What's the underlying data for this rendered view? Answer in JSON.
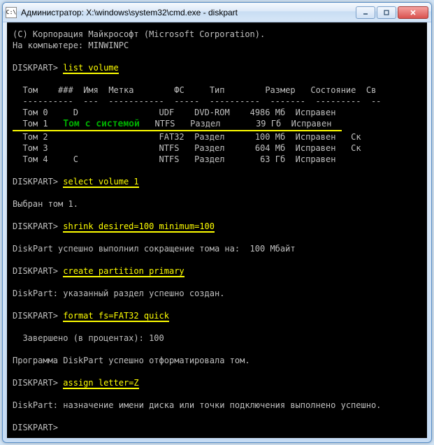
{
  "window": {
    "icon_label": "C:\\",
    "title": "Администратор: X:\\windows\\system32\\cmd.exe - diskpart"
  },
  "copyright": "(C) Корпорация Майкрософт (Microsoft Corporation).",
  "computer_line": "На компьютере: MINWINPC",
  "prompt": "DISKPART>",
  "commands": {
    "list_volume": "list volume",
    "select_volume": "select volume 1",
    "shrink": "shrink desired=100 minimum=100",
    "create_partition": "create partition primary",
    "format": "format fs=FAT32 quick",
    "assign": "assign letter=Z"
  },
  "table": {
    "headers": {
      "vol": "Том",
      "num": "###",
      "ltr": "Имя",
      "label": "Метка",
      "fs": "ФС",
      "type": "Тип",
      "size": "Размер",
      "status": "Состояние",
      "info": "Св"
    },
    "divider": "  ----------  ---  -----------  -----  ----------  -------  ---------  --",
    "rows": [
      {
        "vol": "Том 0",
        "ltr": "D",
        "label": "",
        "fs": "UDF",
        "type": "DVD-ROM",
        "size": "4986 Мб",
        "status": "Исправен",
        "info": ""
      },
      {
        "vol": "Том 1",
        "ltr": "",
        "label": "",
        "fs": "NTFS",
        "type": "Раздел",
        "size": "39 Гб",
        "status": "Исправен",
        "info": ""
      },
      {
        "vol": "Том 2",
        "ltr": "",
        "label": "",
        "fs": "FAT32",
        "type": "Раздел",
        "size": "100 Мб",
        "status": "Исправен",
        "info": "Ск"
      },
      {
        "vol": "Том 3",
        "ltr": "",
        "label": "",
        "fs": "NTFS",
        "type": "Раздел",
        "size": "604 Мб",
        "status": "Исправен",
        "info": "Ск"
      },
      {
        "vol": "Том 4",
        "ltr": "C",
        "label": "",
        "fs": "NTFS",
        "type": "Раздел",
        "size": "63 Гб",
        "status": "Исправен",
        "info": ""
      }
    ]
  },
  "annotation": "Том с системой",
  "messages": {
    "selected": "Выбран том 1.",
    "shrink_ok": "DiskPart успешно выполнил сокращение тома на:  100 Мбайт",
    "partition_ok": "DiskPart: указанный раздел успешно создан.",
    "format_progress": "  Завершено (в процентах): 100",
    "format_ok": "Программа DiskPart успешно отформатировала том.",
    "assign_ok": "DiskPart: назначение имени диска или точки подключения выполнено успешно."
  }
}
